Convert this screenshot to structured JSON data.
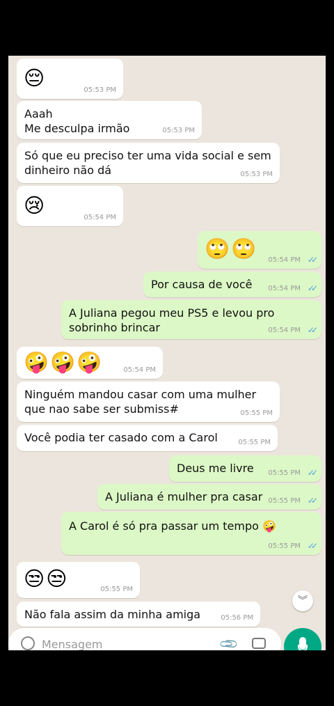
{
  "messages": [
    {
      "emoji": "😔",
      "time": "05:53 PM"
    },
    {
      "text": "Aaah\nMe desculpa irmão",
      "time": "05:53 PM"
    },
    {
      "text": "Só que eu preciso ter uma vida social e sem\ndinheiro não dá",
      "time": "05:53 PM"
    },
    {
      "emoji": "😢",
      "time": "05:54 PM"
    },
    {
      "emoji": "🙄🙄",
      "time": "05:54 PM"
    },
    {
      "text": "Por causa de você",
      "time": "05:54 PM"
    },
    {
      "text": "A Juliana pegou meu PS5 e levou pro\nsobrinho brincar",
      "time": "05:54 PM"
    },
    {
      "emoji": "🤪🤪🤪",
      "time": "05:54 PM"
    },
    {
      "text": "Ninguém mandou casar com uma mulher\nque nao sabe ser submiss#",
      "time": "05:55 PM"
    },
    {
      "text": "Você podia ter casado com a Carol",
      "time": "05:55 PM"
    },
    {
      "text": "Deus me livre",
      "time": "05:55 PM"
    },
    {
      "text": "A Juliana é mulher pra casar",
      "time": "05:55 PM"
    },
    {
      "text": "A Carol é só pra passar um tempo 🤪",
      "time": "05:55 PM"
    },
    {
      "emoji": "😒😒",
      "time": "05:55 PM"
    },
    {
      "text": "Não fala assim da minha amiga",
      "time": "05:56 PM"
    }
  ],
  "ticks": "✓✓",
  "composer": {
    "placeholder": "Mensagem"
  },
  "icons": {
    "scroll_down": "chevron-double-down-icon",
    "attach": "paperclip-icon",
    "camera": "camera-icon",
    "mic": "microphone-icon",
    "emoji": "emoji-icon"
  },
  "colors": {
    "incoming": "#ffffff",
    "outgoing": "#dcf8c6",
    "read_ticks": "#4fa3e0",
    "mic_button": "#00a884"
  }
}
